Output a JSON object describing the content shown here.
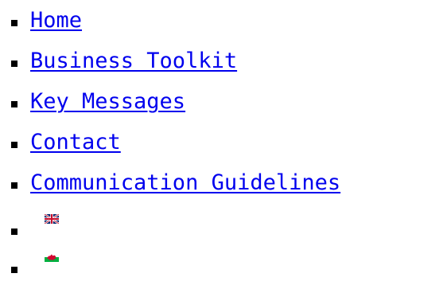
{
  "nav": {
    "items": [
      {
        "label": "Home"
      },
      {
        "label": "Business Toolkit"
      },
      {
        "label": "Key Messages"
      },
      {
        "label": "Contact"
      },
      {
        "label": "Communication Guidelines"
      }
    ],
    "language_flags": [
      {
        "icon": "uk-flag-icon"
      },
      {
        "icon": "wales-flag-icon"
      }
    ]
  },
  "colors": {
    "link": "#0000ee",
    "bullet": "#000000",
    "background": "#ffffff"
  }
}
